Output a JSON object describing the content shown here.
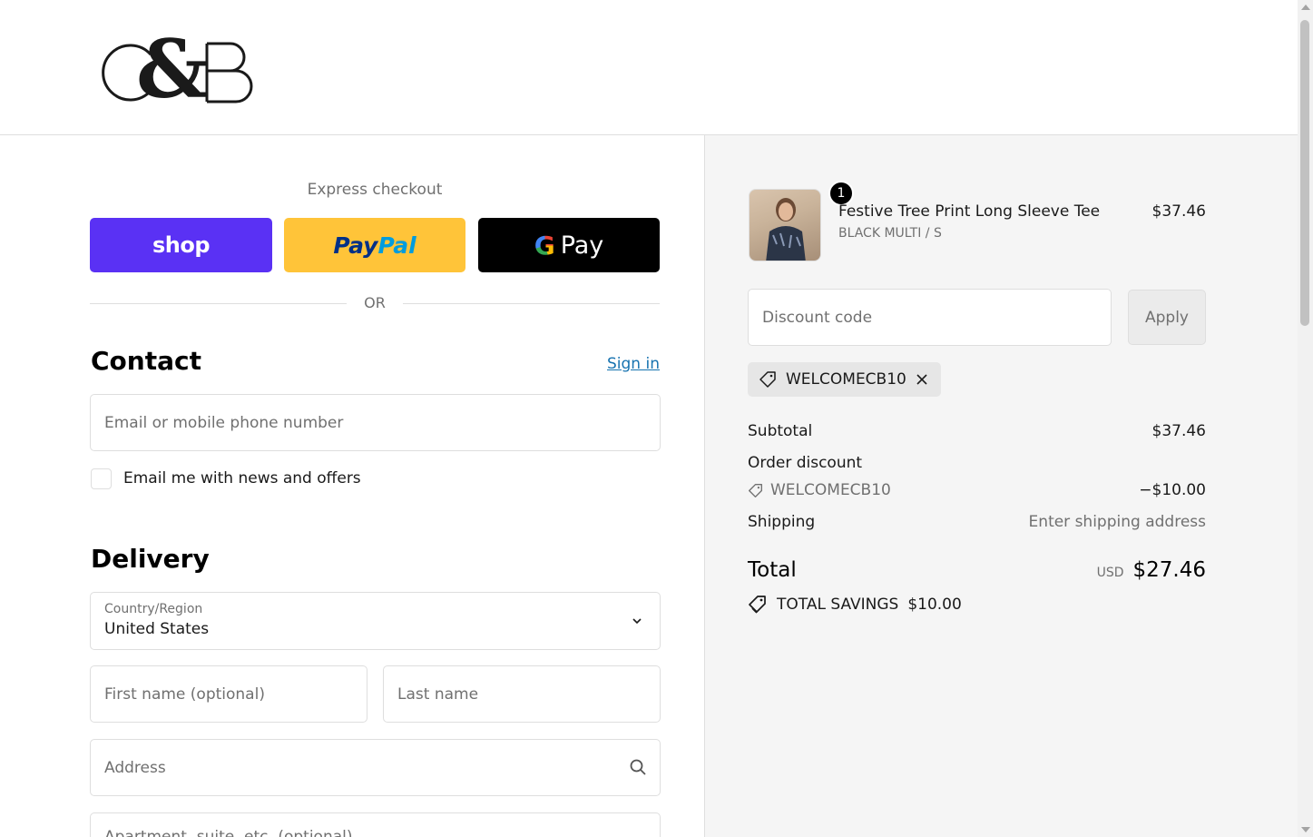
{
  "brand": {
    "logo_text": "C&B"
  },
  "express": {
    "label": "Express checkout",
    "shop_label": "shop",
    "paypal_part1": "Pay",
    "paypal_part2": "Pal",
    "gpay_g": "G",
    "gpay_label": "Pay",
    "or_label": "OR"
  },
  "contact": {
    "title": "Contact",
    "sign_in": "Sign in",
    "email_placeholder": "Email or mobile phone number",
    "newsletter_label": "Email me with news and offers",
    "newsletter_checked": false
  },
  "delivery": {
    "title": "Delivery",
    "country_label": "Country/Region",
    "country_value": "United States",
    "first_name_placeholder": "First name (optional)",
    "last_name_placeholder": "Last name",
    "address_placeholder": "Address",
    "apartment_placeholder": "Apartment, suite, etc. (optional)"
  },
  "summary": {
    "product": {
      "quantity": "1",
      "title": "Festive Tree Print Long Sleeve Tee",
      "variant": "BLACK MULTI / S",
      "price": "$37.46"
    },
    "discount_placeholder": "Discount code",
    "apply_label": "Apply",
    "applied_code": "WELCOMECB10",
    "subtotal_label": "Subtotal",
    "subtotal_value": "$37.46",
    "order_discount_label": "Order discount",
    "order_discount_code": "WELCOMECB10",
    "order_discount_value": "−$10.00",
    "shipping_label": "Shipping",
    "shipping_value": "Enter shipping address",
    "total_label": "Total",
    "total_currency": "USD",
    "total_value": "$27.46",
    "savings_label": "TOTAL SAVINGS",
    "savings_value": "$10.00"
  },
  "colors": {
    "shop": "#5a31f4",
    "paypal": "#ffc439",
    "gpay": "#000000",
    "link": "#1773b0",
    "summary_bg": "#f5f5f5"
  }
}
